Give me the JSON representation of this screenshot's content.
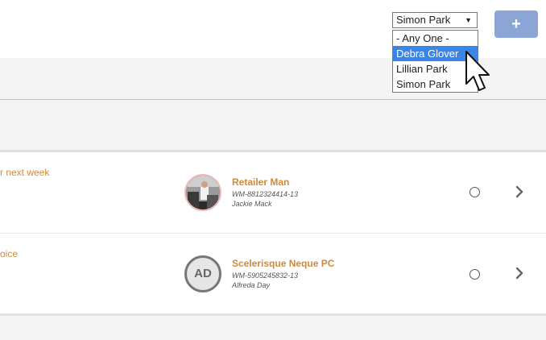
{
  "toolbar": {
    "assignee_selected": "Simon Park",
    "add_label": "+"
  },
  "dropdown": {
    "options": [
      "- Any One -",
      "Debra Glover",
      "Lillian Park",
      "Simon Park"
    ],
    "highlighted": "Debra Glover"
  },
  "rows": [
    {
      "title": "r next week",
      "company": "Retailer Man",
      "work_id": "WM-8812324414-13",
      "contact": "Jackie Mack",
      "avatar_type": "photo"
    },
    {
      "title": "oice",
      "company": "Scelerisque Neque PC",
      "work_id": "WM-5905245832-13",
      "contact": "Alfreda Day",
      "avatar_initials": "AD"
    }
  ],
  "icons": [
    "dropdown-arrow-icon",
    "plus-icon",
    "radio-icon",
    "chevron-right-icon",
    "mouse-pointer-icon"
  ],
  "colors": {
    "accent_orange": "#d08a3a",
    "button_blue": "#8ba6d4",
    "selection_blue": "#3a86e8",
    "gold_line": "#e8c060"
  }
}
